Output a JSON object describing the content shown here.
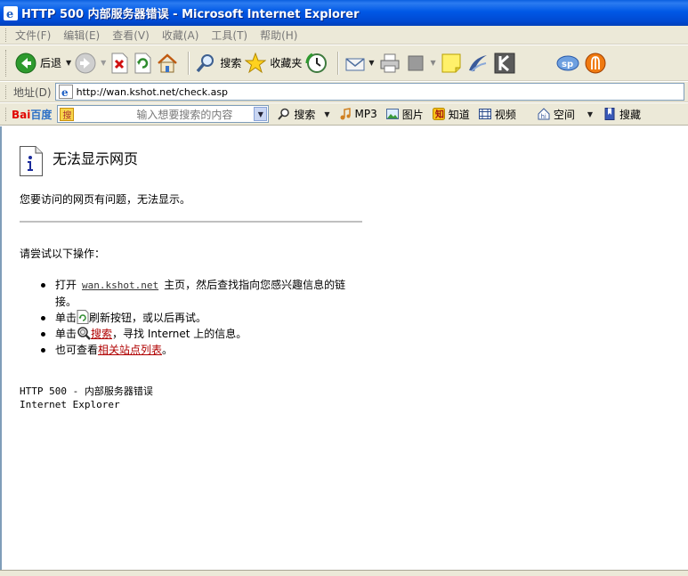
{
  "window": {
    "title": "HTTP 500 内部服务器错误 - Microsoft Internet Explorer"
  },
  "menu": {
    "items": [
      "文件(F)",
      "编辑(E)",
      "查看(V)",
      "收藏(A)",
      "工具(T)",
      "帮助(H)"
    ]
  },
  "toolbar": {
    "back_label": "后退",
    "search_label": "搜索",
    "favorites_label": "收藏夹"
  },
  "address": {
    "label": "地址(D)",
    "url": "http://wan.kshot.net/check.asp"
  },
  "baidu": {
    "logo_bai": "Bai",
    "logo_du": "百度",
    "input_tag": "搜",
    "placeholder": "输入想要搜索的内容",
    "search_label": "搜索",
    "mp3_label": "MP3",
    "images_label": "图片",
    "zhidao_label": "知道",
    "video_label": "视频",
    "space_label": "空间",
    "hide_label": "搜藏"
  },
  "page": {
    "title": "无法显示网页",
    "description": "您要访问的网页有问题，无法显示。",
    "try_label": "请尝试以下操作：",
    "suggestions": {
      "s1_prefix": "打开",
      "s1_link": "wan.kshot.net",
      "s1_suffix": "主页，然后查找指向您感兴趣信息的链接。",
      "s2_prefix": "单击",
      "s2_suffix": "刷新按钮，或以后再试。",
      "s3_prefix": "单击",
      "s3_link": "搜索",
      "s3_suffix": "，寻找 Internet 上的信息。",
      "s4_prefix": "也可查看",
      "s4_link": "相关站点列表",
      "s4_suffix": "。"
    },
    "error_code": "HTTP 500 - 内部服务器错误",
    "error_app": "Internet Explorer"
  }
}
